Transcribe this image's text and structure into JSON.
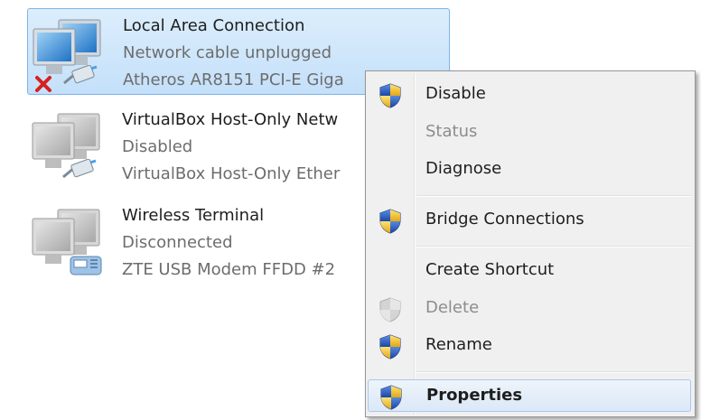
{
  "connections": [
    {
      "name": "Local Area Connection",
      "status": "Network cable unplugged",
      "device": "Atheros AR8151 PCI-E Giga",
      "icon": "network-computer-cable-unplugged-icon"
    },
    {
      "name": "VirtualBox Host-Only Netw",
      "status": "Disabled",
      "device": "VirtualBox Host-Only Ether",
      "icon": "network-computer-cable-disabled-icon"
    },
    {
      "name": "Wireless Terminal",
      "status": "Disconnected",
      "device": "ZTE USB Modem FFDD #2",
      "icon": "network-computer-modem-icon"
    }
  ],
  "context_menu": {
    "items": [
      {
        "label": "Disable",
        "icon": "uac-shield-icon",
        "enabled": true
      },
      {
        "label": "Status",
        "enabled": false
      },
      {
        "label": "Diagnose",
        "enabled": true
      },
      {
        "label": "Bridge Connections",
        "icon": "uac-shield-icon",
        "enabled": true
      },
      {
        "label": "Create Shortcut",
        "enabled": true
      },
      {
        "label": "Delete",
        "icon": "uac-shield-icon",
        "enabled": false
      },
      {
        "label": "Rename",
        "icon": "uac-shield-icon",
        "enabled": true
      },
      {
        "label": "Properties",
        "icon": "uac-shield-icon",
        "enabled": true,
        "default": true,
        "highlighted": true
      }
    ]
  },
  "colors": {
    "selection": "#c4e0fa",
    "selection_border": "#7eb4ea",
    "menu_background": "#f0f0f0",
    "disabled_text": "#8d8d8d",
    "error_x": "#d81f1f"
  }
}
